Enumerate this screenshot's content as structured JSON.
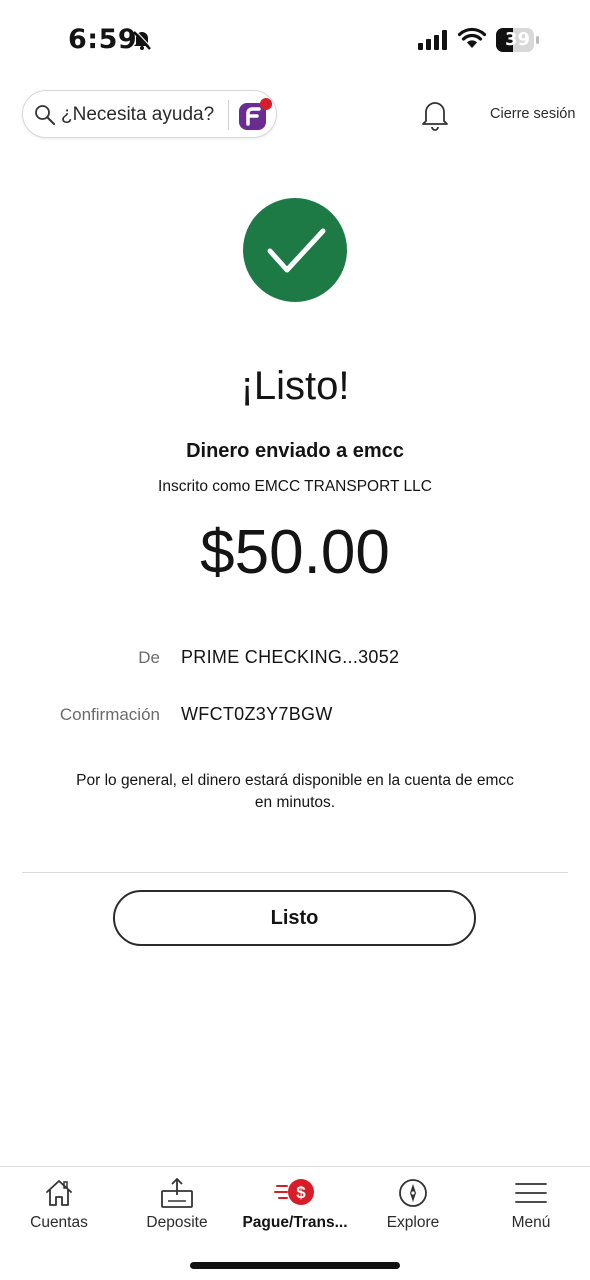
{
  "status_bar": {
    "time": "6:59",
    "battery": "39"
  },
  "header": {
    "search_placeholder": "¿Necesita ayuda?",
    "logout_label": "Cierre sesión"
  },
  "confirmation": {
    "title": "¡Listo!",
    "subtitle": "Dinero enviado a emcc",
    "enrolled_as": "Inscrito como EMCC TRANSPORT LLC",
    "amount": "$50.00",
    "from_label": "De",
    "from_value": "PRIME CHECKING...3052",
    "confirmation_label": "Confirmación",
    "confirmation_value": "WFCT0Z3Y7BGW",
    "note": "Por lo general, el dinero estará disponible en la cuenta de emcc en minutos.",
    "done_button": "Listo"
  },
  "tab_bar": {
    "tabs": [
      {
        "label": "Cuentas",
        "icon": "home-icon"
      },
      {
        "label": "Deposite",
        "icon": "deposit-icon"
      },
      {
        "label": "Pague/Trans...",
        "icon": "pay-transfer-icon",
        "active": true
      },
      {
        "label": "Explore",
        "icon": "compass-icon"
      },
      {
        "label": "Menú",
        "icon": "hamburger-menu-icon"
      }
    ]
  },
  "colors": {
    "success_green": "#1e7a45",
    "accent_red": "#d71e28",
    "fargo_purple": "#6b2c91"
  }
}
